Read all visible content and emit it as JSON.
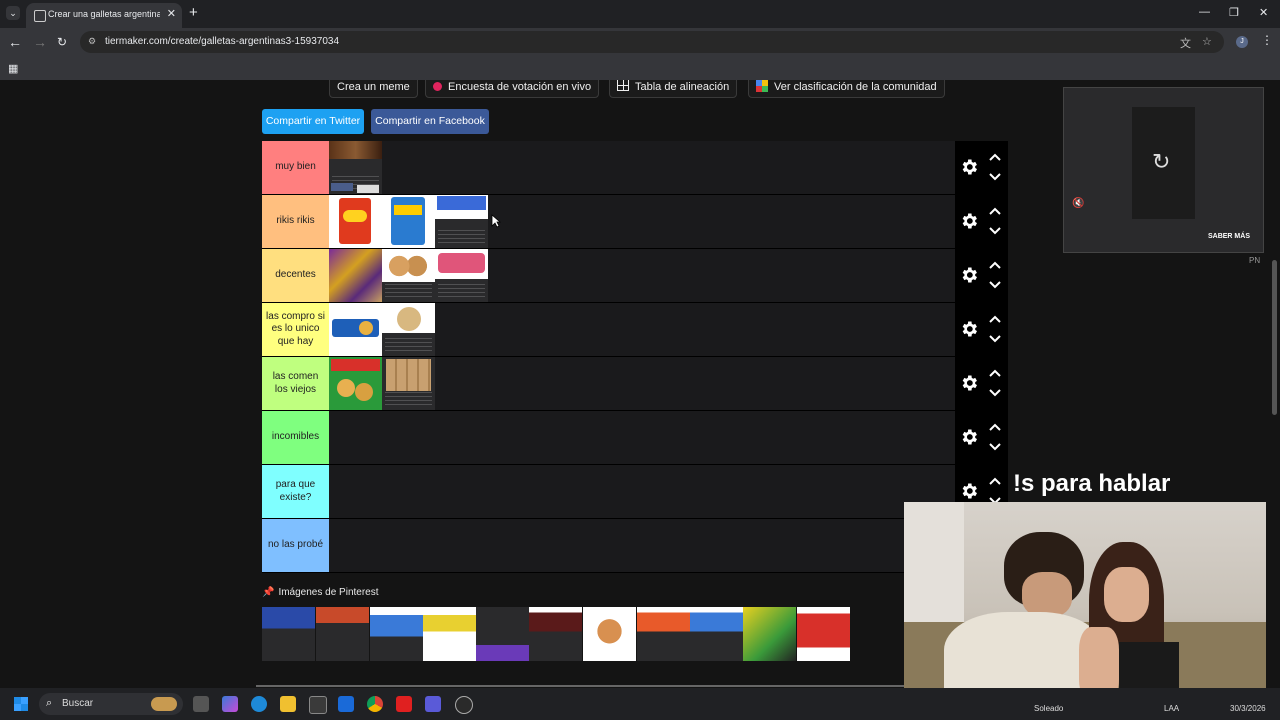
{
  "browser": {
    "tab_title": "Crear una galletas argentinas3",
    "url": "tiermaker.com/create/galletas-argentinas3-15937034",
    "profile_initial": "J"
  },
  "top_buttons": {
    "meme": "Crea un meme",
    "poll": "Encuesta de votación en vivo",
    "align": "Tabla de alineación",
    "community": "Ver clasificación de la comunidad"
  },
  "share": {
    "twitter": "Compartir en Twitter",
    "facebook": "Compartir en Facebook",
    "twitter_color": "#1da1f2",
    "facebook_color": "#3b5998"
  },
  "tiers": [
    {
      "label": "muy bien",
      "color": "#ff7f7f",
      "items": [
        "cookie-photo-card"
      ]
    },
    {
      "label": "rikis rikis",
      "color": "#ffbf7f",
      "items": [
        "rex-crackers",
        "kesitas-crackers",
        "pinterest-card-blue"
      ]
    },
    {
      "label": "decentes",
      "color": "#ffdf7f",
      "items": [
        "mixed-cookies-bags",
        "filled-biscuits",
        "pink-cookies"
      ]
    },
    {
      "label": "las compro si es lo unico que hay",
      "color": "#ffff7f",
      "items": [
        "porteñitas-crackers",
        "round-cookies"
      ]
    },
    {
      "label": "las comen los viejos",
      "color": "#bfff7f",
      "items": [
        "terrabusi-cookies",
        "rolled-biscuits"
      ]
    },
    {
      "label": "incomibles",
      "color": "#7fff7f",
      "items": []
    },
    {
      "label": "para que existe?",
      "color": "#7fffff",
      "items": []
    },
    {
      "label": "no las probé",
      "color": "#7fbfff",
      "items": []
    }
  ],
  "pinterest": {
    "title": "Imágenes de Pinterest",
    "count": 11
  },
  "ad": {
    "cta": "SABER MÁS",
    "badge": "PN"
  },
  "overlay": {
    "text": "!s para hablar"
  },
  "taskbar": {
    "search": "Buscar",
    "weather": "Soleado",
    "lang": "LAA",
    "date": "30/3/2026"
  }
}
